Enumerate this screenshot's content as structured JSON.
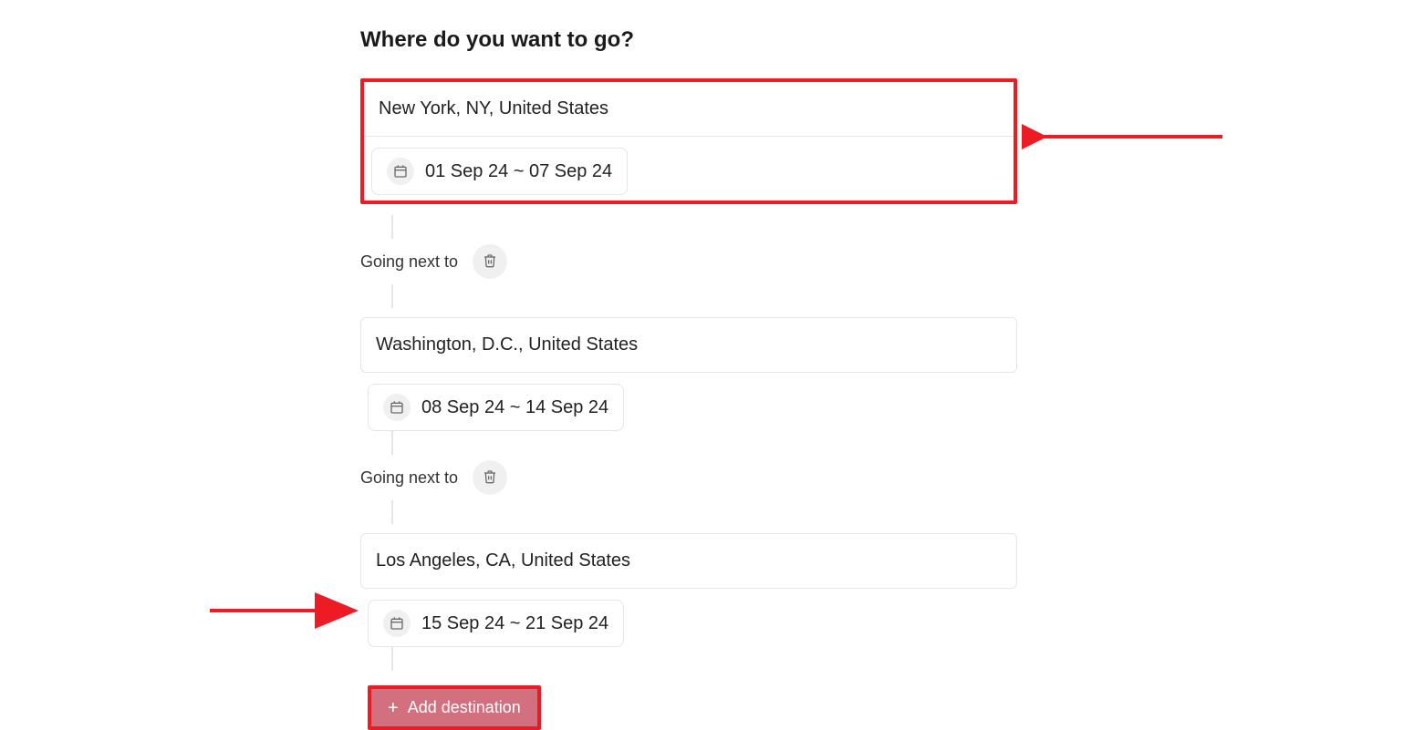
{
  "heading": "Where do you want to go?",
  "going_next_label": "Going next to",
  "add_destination_label": "Add destination",
  "destinations": [
    {
      "location": "New York, NY, United States",
      "dates": "01 Sep 24 ~ 07 Sep 24"
    },
    {
      "location": "Washington, D.C., United States",
      "dates": "08 Sep 24 ~ 14 Sep 24"
    },
    {
      "location": "Los Angeles, CA, United States",
      "dates": "15 Sep 24 ~ 21 Sep 24"
    }
  ],
  "annotations": {
    "highlight_first_destination": true,
    "highlight_add_button": true,
    "arrow_color": "#ed1c24"
  }
}
